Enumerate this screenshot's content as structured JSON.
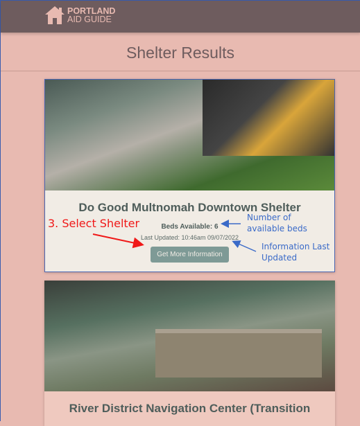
{
  "header": {
    "logo_line1": "PORTLAND",
    "logo_line2": "AID GUIDE"
  },
  "page_title": "Shelter Results",
  "shelters": [
    {
      "name": "Do Good Multnomah Downtown Shelter",
      "beds": "Beds Available: 6",
      "updated": "Last Updated: 10:46am 09/07/2022",
      "button": "Get More Information"
    },
    {
      "name": "River District Navigation Center (Transition"
    }
  ],
  "annotations": {
    "step": "3. Select Shelter",
    "beds_note": "Number of available beds",
    "updated_note": "Information Last Updated",
    "step_color": "#f01818",
    "note_color": "#3a6ac8"
  }
}
